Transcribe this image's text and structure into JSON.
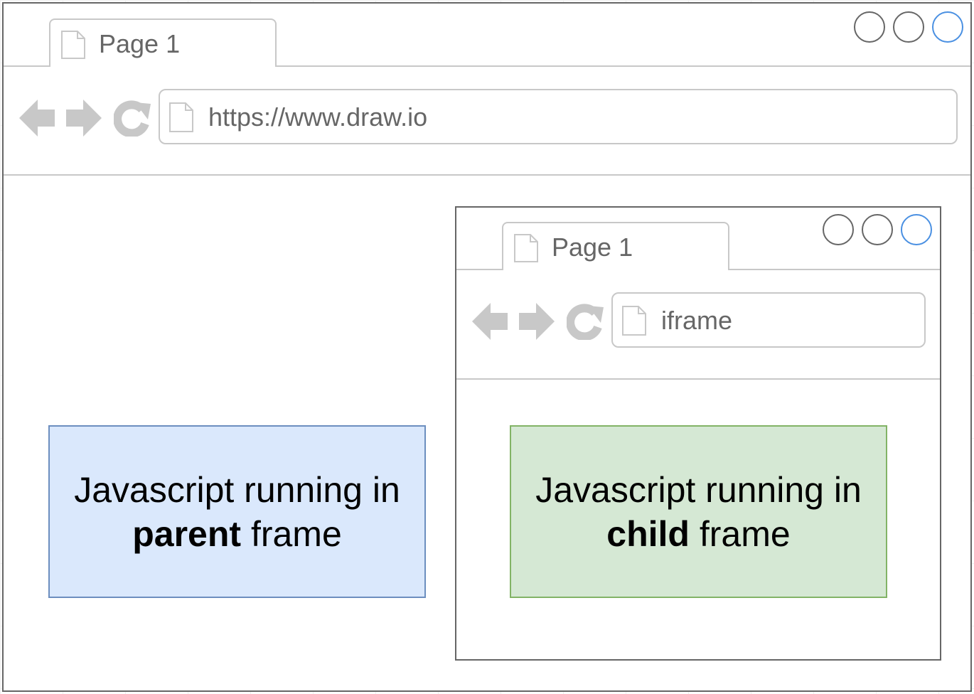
{
  "outer_browser": {
    "tab_title": "Page 1",
    "url": "https://www.draw.io",
    "icons": [
      "document-icon",
      "back-arrow-icon",
      "forward-arrow-icon",
      "reload-icon"
    ]
  },
  "inner_browser": {
    "tab_title": "Page 1",
    "url": "iframe",
    "icons": [
      "document-icon",
      "back-arrow-icon",
      "forward-arrow-icon",
      "reload-icon"
    ]
  },
  "parent_box": {
    "line1": "Javascript running in",
    "bold": "parent",
    "rest": " frame",
    "fill": "#dae8fc",
    "stroke": "#6c8ebf"
  },
  "child_box": {
    "line1": "Javascript running in",
    "bold": "child",
    "rest": " frame",
    "fill": "#d5e8d4",
    "stroke": "#82b366"
  },
  "colors": {
    "window_border": "#666666",
    "chrome_gray": "#c8c8c8",
    "maximize_accent": "#4a90e2"
  }
}
